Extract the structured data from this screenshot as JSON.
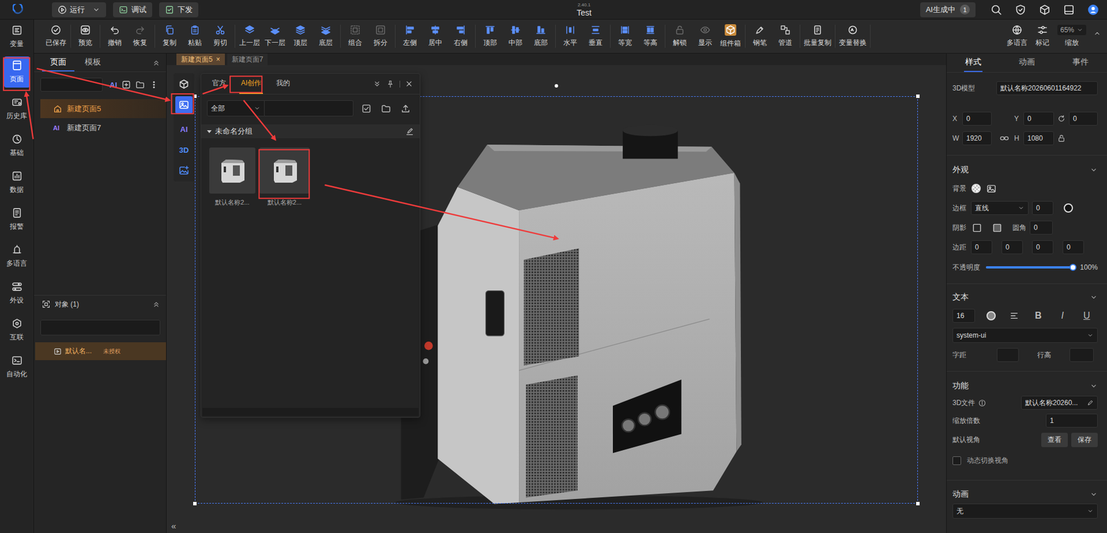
{
  "topbar": {
    "run": "运行",
    "debug": "调试",
    "deploy": "下发",
    "version": "2.40.1",
    "title": "Test",
    "ai_status": "AI生成中",
    "ai_count": "1"
  },
  "toolbar": {
    "groups": [
      [
        {
          "label": "已保存",
          "state": "normal"
        }
      ],
      [
        {
          "label": "预览",
          "state": "normal"
        }
      ],
      [
        {
          "label": "撤销",
          "state": "normal"
        },
        {
          "label": "恢复",
          "state": "disabled"
        }
      ],
      [
        {
          "label": "复制",
          "state": "normal"
        },
        {
          "label": "粘贴",
          "state": "normal"
        },
        {
          "label": "剪切",
          "state": "normal"
        }
      ],
      [
        {
          "label": "上一层",
          "state": "normal"
        },
        {
          "label": "下一层",
          "state": "normal"
        },
        {
          "label": "顶层",
          "state": "normal"
        },
        {
          "label": "底层",
          "state": "normal"
        }
      ],
      [
        {
          "label": "组合",
          "state": "disabled"
        },
        {
          "label": "拆分",
          "state": "disabled"
        }
      ],
      [
        {
          "label": "左侧",
          "state": "normal"
        },
        {
          "label": "居中",
          "state": "normal"
        },
        {
          "label": "右侧",
          "state": "normal"
        }
      ],
      [
        {
          "label": "顶部",
          "state": "normal"
        },
        {
          "label": "中部",
          "state": "normal"
        },
        {
          "label": "底部",
          "state": "normal"
        }
      ],
      [
        {
          "label": "水平",
          "state": "normal"
        },
        {
          "label": "垂直",
          "state": "normal"
        }
      ],
      [
        {
          "label": "等宽",
          "state": "normal"
        },
        {
          "label": "等高",
          "state": "normal"
        }
      ],
      [
        {
          "label": "解锁",
          "state": "disabled"
        },
        {
          "label": "显示",
          "state": "disabled"
        },
        {
          "label": "组件箱",
          "state": "active"
        }
      ],
      [
        {
          "label": "钢笔",
          "state": "normal"
        },
        {
          "label": "管道",
          "state": "normal"
        }
      ],
      [
        {
          "label": "批量复制",
          "state": "normal"
        }
      ],
      [
        {
          "label": "变量替换",
          "state": "normal"
        }
      ]
    ],
    "right": [
      {
        "label": "多语言"
      },
      {
        "label": "标记"
      }
    ],
    "zoom": {
      "value": "65%",
      "label": "缩放"
    }
  },
  "left_nav": [
    {
      "label": "变量",
      "selected": false
    },
    {
      "label": "页面",
      "selected": true
    },
    {
      "label": "历史库",
      "selected": false
    },
    {
      "label": "基础",
      "selected": false
    },
    {
      "label": "数据",
      "selected": false
    },
    {
      "label": "报警",
      "selected": false
    },
    {
      "label": "多语言",
      "selected": false
    },
    {
      "label": "外设",
      "selected": false
    },
    {
      "label": "互联",
      "selected": false
    },
    {
      "label": "自动化",
      "selected": false
    }
  ],
  "pages_panel": {
    "tabs": [
      {
        "label": "页面",
        "selected": true
      },
      {
        "label": "模板",
        "selected": false
      }
    ],
    "search_ai": "AI",
    "pages": [
      {
        "label": "新建页面5",
        "selected": true,
        "kind": "home"
      },
      {
        "label": "新建页面7",
        "selected": false,
        "kind": "ai",
        "mark": "AI"
      }
    ],
    "objects": {
      "title": "对象 (1)",
      "items": [
        {
          "label": "默认名...",
          "badge": "未授权",
          "selected": true
        }
      ]
    },
    "collapse": "«"
  },
  "tool_strip": [
    {
      "kind": "cube",
      "selected": false
    },
    {
      "kind": "image",
      "selected": true
    },
    {
      "kind": "ai",
      "label": "AI",
      "selected": false
    },
    {
      "kind": "3d",
      "label": "3D",
      "selected": false
    },
    {
      "kind": "image-add",
      "selected": false
    }
  ],
  "library": {
    "tabs": [
      {
        "label": "官方",
        "selected": false
      },
      {
        "label": "AI创作",
        "selected": true
      },
      {
        "label": "我的",
        "selected": false
      }
    ],
    "filter": "全部",
    "group": {
      "label": "未命名分组",
      "expanded": true
    },
    "items": [
      {
        "label": "默认名称2..."
      },
      {
        "label": "默认名称2..."
      }
    ]
  },
  "canvas": {
    "tabs": [
      {
        "label": "新建页面5",
        "selected": true,
        "close": "×"
      },
      {
        "label": "新建页面7",
        "selected": false
      }
    ]
  },
  "inspector": {
    "tabs": [
      {
        "label": "样式",
        "selected": true
      },
      {
        "label": "动画",
        "selected": false
      },
      {
        "label": "事件",
        "selected": false
      }
    ],
    "model": {
      "label": "3D模型",
      "value": "默认名称20260601164922"
    },
    "x": {
      "label": "X",
      "value": "0"
    },
    "y": {
      "label": "Y",
      "value": "0"
    },
    "rotation": {
      "value": "0"
    },
    "w": {
      "label": "W",
      "value": "1920"
    },
    "h": {
      "label": "H",
      "value": "1080"
    },
    "appearance": {
      "title": "外观",
      "expanded": true,
      "background": {
        "label": "背景"
      },
      "border": {
        "label": "边框",
        "style": "直线",
        "width": "0"
      },
      "shadow": {
        "label": "阴影",
        "radius_label": "圆角",
        "radius": "0"
      },
      "padding": {
        "label": "边距",
        "values": [
          "0",
          "0",
          "0",
          "0"
        ]
      },
      "opacity": {
        "label": "不透明度",
        "level": 1,
        "reading": "100%"
      }
    },
    "text": {
      "title": "文本",
      "expanded": true,
      "size": "16",
      "bold": "B",
      "italic": "I",
      "underline": "U",
      "font": "system-ui",
      "spacing_label": "字距",
      "line_label": "行高"
    },
    "function": {
      "title": "功能",
      "expanded": true,
      "file_label": "3D文件",
      "file": "默认名称20260...",
      "scale_label": "缩放倍数",
      "scale": "1",
      "view_label": "默认视角",
      "view_buttons": [
        "查看",
        "保存"
      ],
      "dynamic": {
        "label": "动态切换视角",
        "checked": false
      }
    },
    "animation": {
      "title": "动画",
      "expanded": true,
      "value": "无"
    }
  }
}
